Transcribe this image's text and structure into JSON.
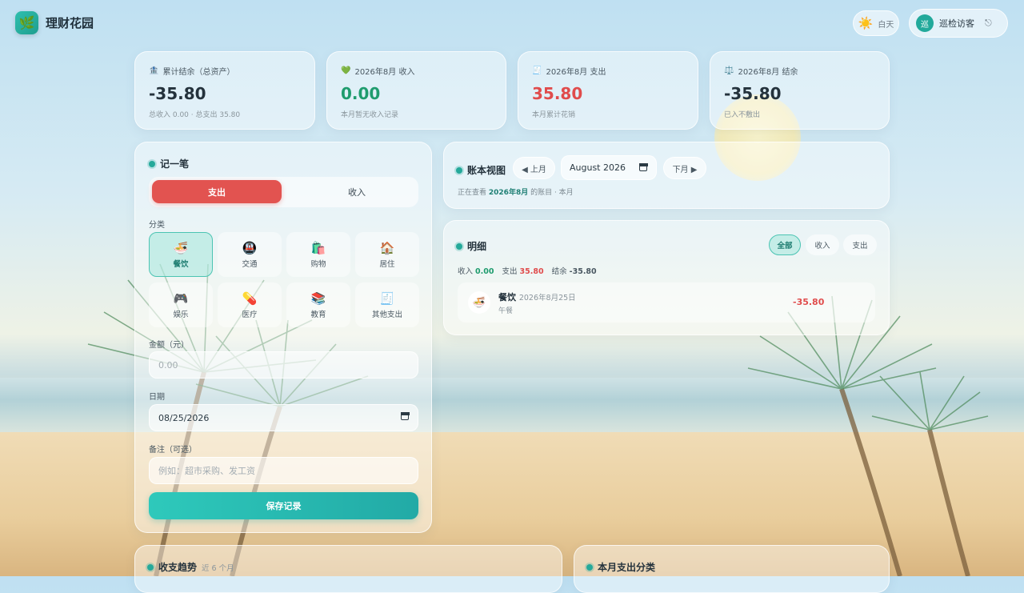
{
  "app": {
    "name": "理财花园",
    "logo_icon": "🌿"
  },
  "header": {
    "theme_icon": "☀️",
    "theme_label": "白天",
    "avatar_text": "巡",
    "user_name": "巡检访客",
    "logout_icon": "⎋"
  },
  "stats": [
    {
      "icon": "🏦",
      "label": "累计结余（总资产）",
      "value": "-35.80",
      "sub": "总收入 0.00 · 总支出 35.80"
    },
    {
      "icon": "💚",
      "label": "2026年8月 收入",
      "value": "0.00",
      "sub": "本月暂无收入记录"
    },
    {
      "icon": "🧾",
      "label": "2026年8月 支出",
      "value": "35.80",
      "sub": "本月累计花销"
    },
    {
      "icon": "⚖️",
      "label": "2026年8月 结余",
      "value": "-35.80",
      "sub": "已入不敷出"
    }
  ],
  "form": {
    "title": "记一笔",
    "type_expense": "支出",
    "type_income": "收入",
    "category_label": "分类",
    "categories": [
      {
        "icon": "🍜",
        "label": "餐饮"
      },
      {
        "icon": "🚇",
        "label": "交通"
      },
      {
        "icon": "🛍️",
        "label": "购物"
      },
      {
        "icon": "🏠",
        "label": "居住"
      },
      {
        "icon": "🎮",
        "label": "娱乐"
      },
      {
        "icon": "💊",
        "label": "医疗"
      },
      {
        "icon": "📚",
        "label": "教育"
      },
      {
        "icon": "🧾",
        "label": "其他支出"
      }
    ],
    "selected_category": "餐饮",
    "amount_label": "金额（元）",
    "amount_placeholder": "0.00",
    "date_label": "日期",
    "date_value": "08/25/2026",
    "note_label": "备注（可选）",
    "note_placeholder": "例如：超市采购、发工资",
    "save_label": "保存记录"
  },
  "ledger": {
    "title": "账本视图",
    "prev_label": "◀ 上月",
    "month_value": "August 2026",
    "next_label": "下月 ▶",
    "viewing_prefix": "正在查看",
    "viewing_month": "2026年8月",
    "viewing_suffix": "的账目 · 本月"
  },
  "details": {
    "title": "明细",
    "filters": [
      "全部",
      "收入",
      "支出"
    ],
    "income_label": "收入",
    "income_value": "0.00",
    "expense_label": "支出",
    "expense_value": "35.80",
    "balance_label": "结余",
    "balance_value": "-35.80",
    "entries": [
      {
        "icon": "🍜",
        "category": "餐饮",
        "date": "2026年8月25日",
        "note": "午餐",
        "amount": "-35.80"
      }
    ]
  },
  "trend": {
    "title": "收支趋势",
    "subtitle": "近 6 个月"
  },
  "category_breakdown": {
    "title": "本月支出分类"
  },
  "colors": {
    "accent": "#25a99a",
    "expense": "#e25350",
    "income": "#1f9c6e"
  }
}
